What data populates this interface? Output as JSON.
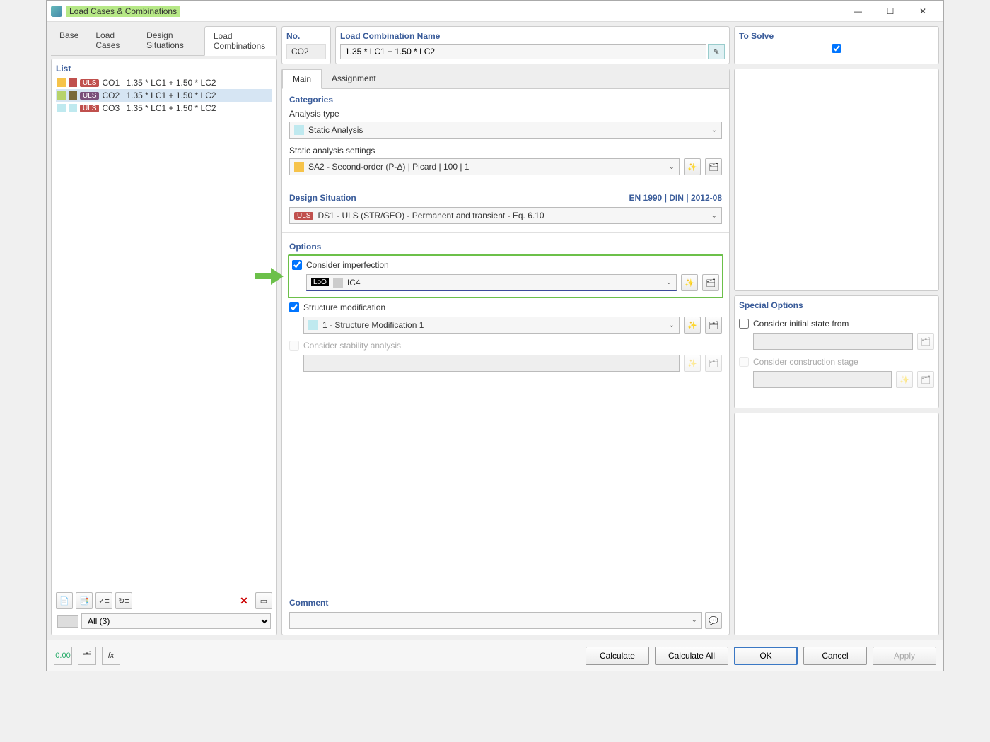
{
  "window_title": "Load Cases & Combinations",
  "tabs": [
    "Base",
    "Load Cases",
    "Design Situations",
    "Load Combinations"
  ],
  "active_tab": 3,
  "list": {
    "title": "List",
    "filter_label": "All (3)",
    "items": [
      {
        "color1": "#f6c34a",
        "color2": "#c0504d",
        "badge": "ULS",
        "badge_cls": "uls",
        "co": "CO1",
        "desc": "1.35 * LC1 + 1.50 * LC2",
        "sel": false
      },
      {
        "color1": "#b7d36a",
        "color2": "#7a6a3a",
        "badge": "ULS",
        "badge_cls": "uls2",
        "co": "CO2",
        "desc": "1.35 * LC1 + 1.50 * LC2",
        "sel": true
      },
      {
        "color1": "#bfe9ef",
        "color2": "#bfe9ef",
        "badge": "ULS",
        "badge_cls": "uls",
        "co": "CO3",
        "desc": "1.35 * LC1 + 1.50 * LC2",
        "sel": false
      }
    ]
  },
  "header": {
    "no_title": "No.",
    "no_value": "CO2",
    "name_title": "Load Combination Name",
    "name_value": "1.35 * LC1 + 1.50 * LC2",
    "solve_title": "To Solve"
  },
  "subtabs": [
    "Main",
    "Assignment"
  ],
  "categories": {
    "title": "Categories",
    "analysis_type_label": "Analysis type",
    "analysis_type_value": "Static Analysis",
    "analysis_type_color": "#bfe9ef",
    "static_settings_label": "Static analysis settings",
    "static_settings_value": "SA2 - Second-order (P-Δ) | Picard | 100 | 1",
    "static_settings_color": "#f6c34a"
  },
  "design_situation": {
    "title": "Design Situation",
    "standard": "EN 1990 | DIN | 2012-08",
    "badge": "ULS",
    "value": "DS1 - ULS (STR/GEO) - Permanent and transient - Eq. 6.10"
  },
  "options": {
    "title": "Options",
    "imperfection_label": "Consider imperfection",
    "imperfection_value": "IC4",
    "imperfection_tag": "LoO",
    "structure_mod_label": "Structure modification",
    "structure_mod_value": "1 - Structure Modification 1",
    "structure_mod_color": "#bfe9ef",
    "stability_label": "Consider stability analysis"
  },
  "special": {
    "title": "Special Options",
    "initial_state_label": "Consider initial state from",
    "construction_stage_label": "Consider construction stage"
  },
  "comment_title": "Comment",
  "footer": {
    "calculate": "Calculate",
    "calculate_all": "Calculate All",
    "ok": "OK",
    "cancel": "Cancel",
    "apply": "Apply"
  }
}
